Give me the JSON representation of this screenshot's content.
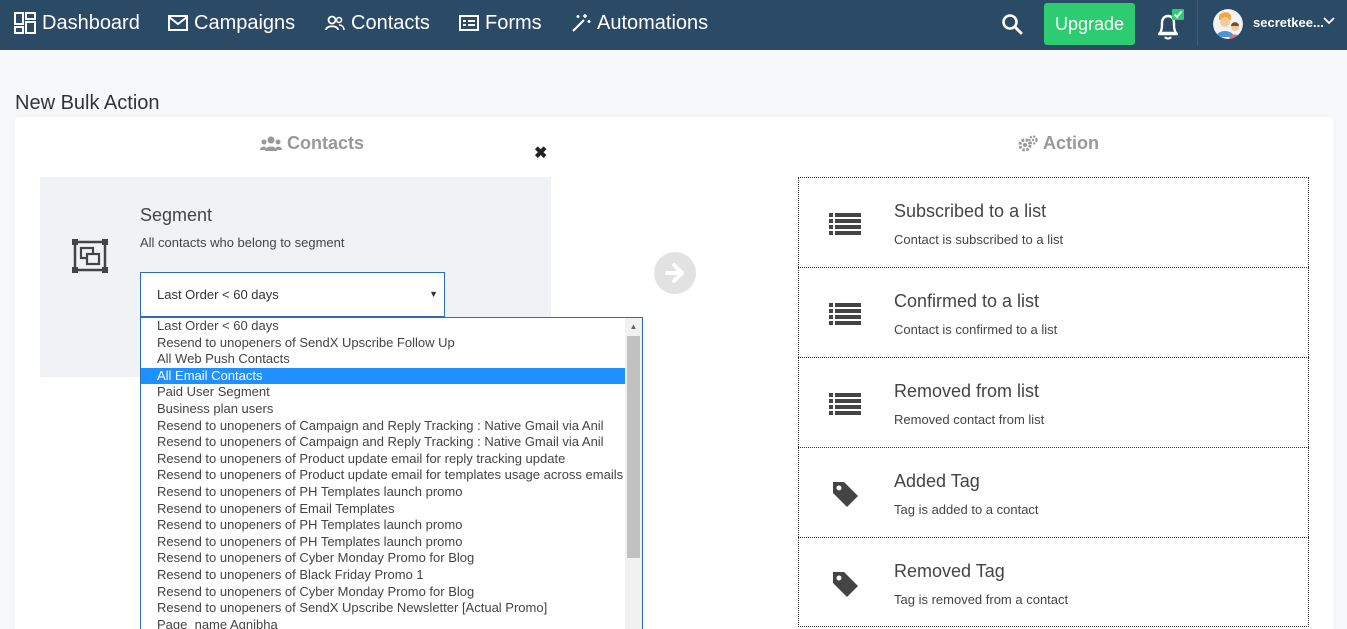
{
  "nav": {
    "items": [
      {
        "label": "Dashboard",
        "icon": "dashboard-icon"
      },
      {
        "label": "Campaigns",
        "icon": "envelope-icon"
      },
      {
        "label": "Contacts",
        "icon": "users-icon"
      },
      {
        "label": "Forms",
        "icon": "form-icon"
      },
      {
        "label": "Automations",
        "icon": "magic-wand-icon"
      }
    ],
    "upgrade_label": "Upgrade",
    "user_name": "secretkee...",
    "colors": {
      "bar": "#2b4a66",
      "upgrade": "#2ecc71",
      "notification_badge": "#2ecc71"
    }
  },
  "page": {
    "title": "New Bulk Action"
  },
  "contacts": {
    "heading": "Contacts",
    "segment_title": "Segment",
    "segment_desc": "All contacts who belong to segment",
    "selected_segment": "Last Order < 60 days",
    "options": [
      "Last Order < 60 days",
      "Resend to unopeners of SendX Upscribe Follow Up",
      "All Web Push Contacts",
      "All Email Contacts",
      "Paid User Segment",
      "Business plan users",
      "Resend to unopeners of Campaign and Reply Tracking : Native Gmail via Anil",
      "Resend to unopeners of Campaign and Reply Tracking : Native Gmail via Anil",
      "Resend to unopeners of Product update email for reply tracking update",
      "Resend to unopeners of Product update email for templates usage across emails",
      "Resend to unopeners of PH Templates launch promo",
      "Resend to unopeners of Email Templates",
      "Resend to unopeners of PH Templates launch promo",
      "Resend to unopeners of PH Templates launch promo",
      "Resend to unopeners of Cyber Monday Promo for Blog",
      "Resend to unopeners of Black Friday Promo 1",
      "Resend to unopeners of Cyber Monday Promo for Blog",
      "Resend to unopeners of SendX Upscribe Newsletter [Actual Promo]",
      "Page_name Agnibha"
    ],
    "highlighted_option": "All Email Contacts"
  },
  "action": {
    "heading": "Action",
    "items": [
      {
        "title": "Subscribed to a list",
        "desc": "Contact is subscribed to a list",
        "icon": "list-icon"
      },
      {
        "title": "Confirmed to a list",
        "desc": "Contact is confirmed to a list",
        "icon": "list-icon"
      },
      {
        "title": "Removed from list",
        "desc": "Removed contact from list",
        "icon": "list-icon"
      },
      {
        "title": "Added Tag",
        "desc": "Tag is added to a contact",
        "icon": "tag-icon"
      },
      {
        "title": "Removed Tag",
        "desc": "Tag is removed from a contact",
        "icon": "tag-icon"
      }
    ]
  }
}
